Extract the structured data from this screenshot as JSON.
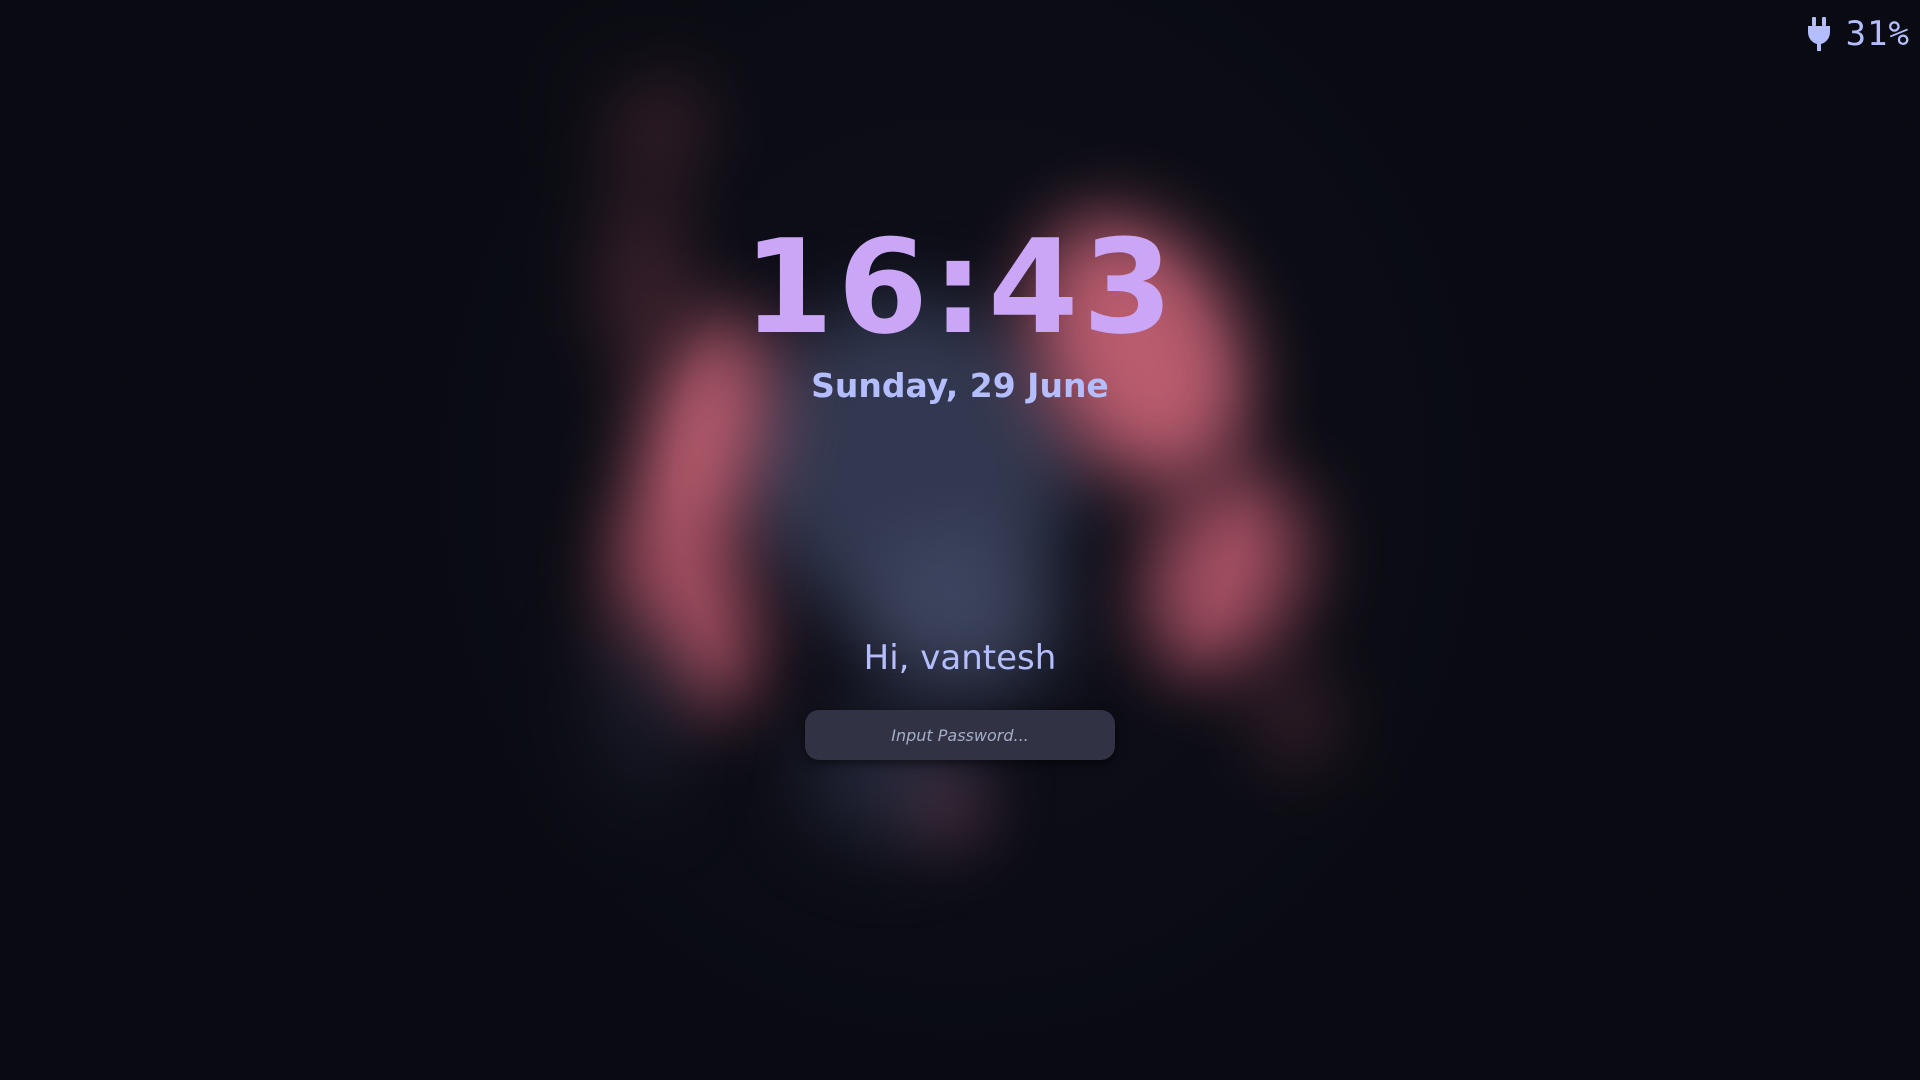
{
  "status": {
    "power_icon": "plug-icon",
    "battery_percent": "31%"
  },
  "lockscreen": {
    "time": "16:43",
    "date": "Sunday, 29 June",
    "greeting": "Hi, vantesh",
    "password_placeholder": "Input Password..."
  },
  "colors": {
    "clock": "#cba6f7",
    "accent_text": "#b4befe",
    "input_background": "#313244",
    "background": "#0b0c14"
  }
}
